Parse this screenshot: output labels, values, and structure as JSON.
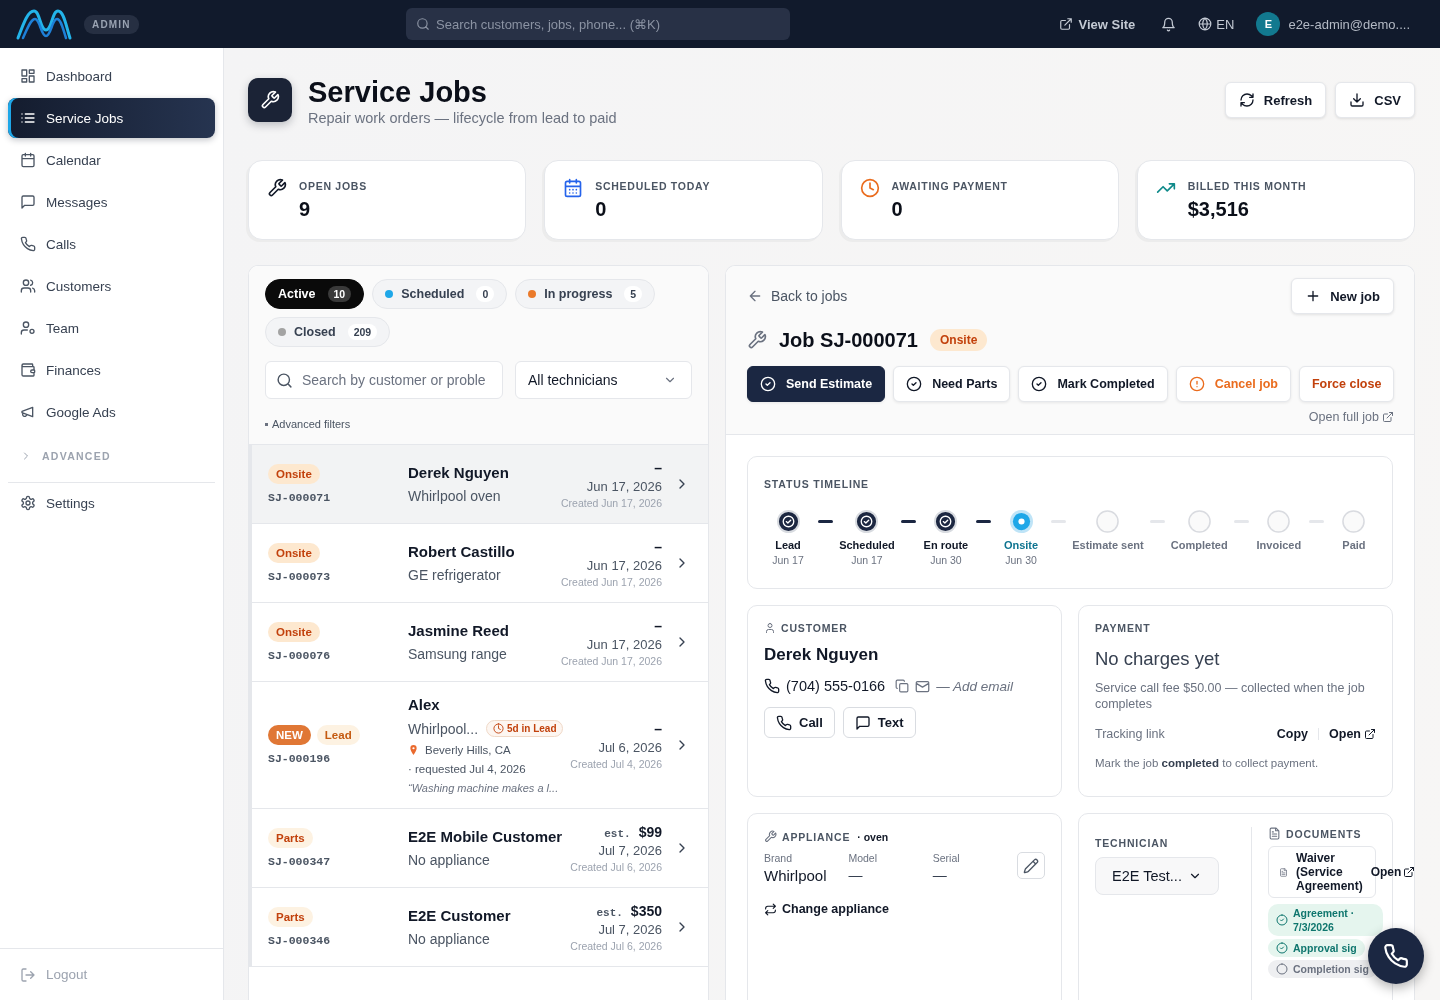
{
  "topbar": {
    "badge": "ADMIN",
    "search": {
      "placeholder": "Search customers, jobs, phone... (⌘K)"
    },
    "view_site": "View Site",
    "language": "EN",
    "avatar": "E",
    "user": "e2e-admin@demo...."
  },
  "sidebar": {
    "items": [
      {
        "label": "Dashboard",
        "selected": false
      },
      {
        "label": "Service Jobs",
        "selected": true
      },
      {
        "label": "Calendar",
        "selected": false
      },
      {
        "label": "Messages",
        "selected": false
      },
      {
        "label": "Calls",
        "selected": false
      },
      {
        "label": "Customers",
        "selected": false
      },
      {
        "label": "Team",
        "selected": false
      },
      {
        "label": "Finances",
        "selected": false
      },
      {
        "label": "Google Ads",
        "selected": false
      }
    ],
    "section": {
      "label": "ADVANCED",
      "expanded": false
    },
    "settings": "Settings",
    "logout": "Logout"
  },
  "page": {
    "title": "Service Jobs",
    "subtitle": "Repair work orders — lifecycle from lead to paid",
    "actions": [
      "Refresh",
      "CSV"
    ]
  },
  "stats": [
    {
      "label": "OPEN JOBS",
      "value": "9"
    },
    {
      "label": "SCHEDULED TODAY",
      "value": "0"
    },
    {
      "label": "AWAITING PAYMENT",
      "value": "0"
    },
    {
      "label": "BILLED THIS MONTH",
      "value": "$3,516"
    }
  ],
  "job_list": {
    "filters": [
      {
        "label": "Active",
        "count": "10",
        "selected": true
      },
      {
        "label": "Scheduled",
        "count": "0",
        "selected": false,
        "color": "#1ea7e8"
      },
      {
        "label": "In progress",
        "count": "5",
        "selected": false,
        "color": "#ea7a2b"
      },
      {
        "label": "Closed",
        "count": "209",
        "selected": false,
        "color": "#a3a3a3"
      }
    ],
    "search": {
      "placeholder": "Search by customer or proble"
    },
    "technician_filter": "All technicians",
    "advanced_filters": "Advanced filters",
    "rows": [
      {
        "badges": [
          {
            "label": "Onsite",
            "kind": "onsite"
          }
        ],
        "id": "SJ-000071",
        "customer": "Derek Nguyen",
        "appliance": "Whirlpool oven",
        "price": "–",
        "date": "Jun 17, 2026",
        "created": "Created Jun 17, 2026",
        "selected": true
      },
      {
        "badges": [
          {
            "label": "Onsite",
            "kind": "onsite"
          }
        ],
        "id": "SJ-000073",
        "customer": "Robert Castillo",
        "appliance": "GE refrigerator",
        "price": "–",
        "date": "Jun 17, 2026",
        "created": "Created Jun 17, 2026",
        "selected": false
      },
      {
        "badges": [
          {
            "label": "Onsite",
            "kind": "onsite"
          }
        ],
        "id": "SJ-000076",
        "customer": "Jasmine Reed",
        "appliance": "Samsung range",
        "price": "–",
        "date": "Jun 17, 2026",
        "created": "Created Jun 17, 2026",
        "selected": false
      },
      {
        "badges": [
          {
            "label": "NEW",
            "kind": "new"
          },
          {
            "label": "Lead",
            "kind": "lead"
          }
        ],
        "id": "SJ-000196",
        "customer": "Alex",
        "appliance": "Whirlpool...",
        "age_tag": "5d in Lead",
        "location": "Beverly Hills, CA",
        "requested": "· requested Jul 4, 2026",
        "note": "“Washing machine makes a l...",
        "price": "–",
        "date": "Jul 6, 2026",
        "created": "Created Jul 4, 2026",
        "selected": false
      },
      {
        "badges": [
          {
            "label": "Parts",
            "kind": "parts"
          }
        ],
        "id": "SJ-000347",
        "customer": "E2E Mobile Customer",
        "appliance": "No appliance",
        "price_prefix": "est.",
        "price": "$99",
        "date": "Jul 7, 2026",
        "created": "Created Jul 6, 2026",
        "selected": false
      },
      {
        "badges": [
          {
            "label": "Parts",
            "kind": "parts"
          }
        ],
        "id": "SJ-000346",
        "customer": "E2E Customer",
        "appliance": "No appliance",
        "price_prefix": "est.",
        "price": "$350",
        "date": "Jul 7, 2026",
        "created": "Created Jul 6, 2026",
        "selected": false
      }
    ]
  },
  "detail": {
    "back": "Back to jobs",
    "new_job": "New job",
    "title": "Job SJ-000071",
    "status": {
      "label": "Onsite",
      "kind": "onsite"
    },
    "actions": [
      {
        "label": "Send Estimate",
        "kind": "primary"
      },
      {
        "label": "Need Parts",
        "kind": "default"
      },
      {
        "label": "Mark Completed",
        "kind": "default"
      },
      {
        "label": "Cancel job",
        "kind": "warning"
      },
      {
        "label": "Force close",
        "kind": "danger"
      }
    ],
    "open_full": "Open full job",
    "timeline": {
      "title": "STATUS TIMELINE",
      "steps": [
        {
          "label": "Lead",
          "date": "Jun 17",
          "done": true,
          "current": false
        },
        {
          "label": "Scheduled",
          "date": "Jun 17",
          "done": true,
          "current": false
        },
        {
          "label": "En route",
          "date": "Jun 30",
          "done": true,
          "current": false
        },
        {
          "label": "Onsite",
          "date": "Jun 30",
          "done": false,
          "current": true
        },
        {
          "label": "Estimate sent",
          "done": false,
          "current": false
        },
        {
          "label": "Completed",
          "done": false,
          "current": false
        },
        {
          "label": "Invoiced",
          "done": false,
          "current": false
        },
        {
          "label": "Paid",
          "done": false,
          "current": false
        }
      ]
    },
    "customer": {
      "title": "CUSTOMER",
      "name": "Derek Nguyen",
      "phone": "(704) 555-0166",
      "email_hint": "— Add email",
      "actions": [
        "Call",
        "Text"
      ]
    },
    "payment": {
      "title": "PAYMENT",
      "headline": "No charges yet",
      "note": "Service call fee $50.00 — collected when the job completes",
      "tracking_label": "Tracking link",
      "tracking_actions": [
        "Copy",
        "Open"
      ],
      "hint": "Mark the job **completed** to collect payment."
    },
    "appliance": {
      "title": "APPLIANCE",
      "type": "· oven",
      "fields": [
        {
          "label": "Brand",
          "value": "Whirlpool"
        },
        {
          "label": "Model",
          "value": "—"
        },
        {
          "label": "Serial",
          "value": "—"
        }
      ],
      "change": "Change appliance"
    },
    "technician": {
      "title": "TECHNICIAN",
      "value": "E2E Test..."
    },
    "documents": {
      "title": "DOCUMENTS",
      "items": [
        {
          "name": "Waiver (Service Agreement)",
          "action": "Open"
        }
      ],
      "signatures": [
        {
          "label": "Agreement · 7/3/2026",
          "signed": true
        },
        {
          "label": "Approval sig",
          "signed": true
        },
        {
          "label": "Completion sig",
          "signed": false
        }
      ]
    }
  }
}
